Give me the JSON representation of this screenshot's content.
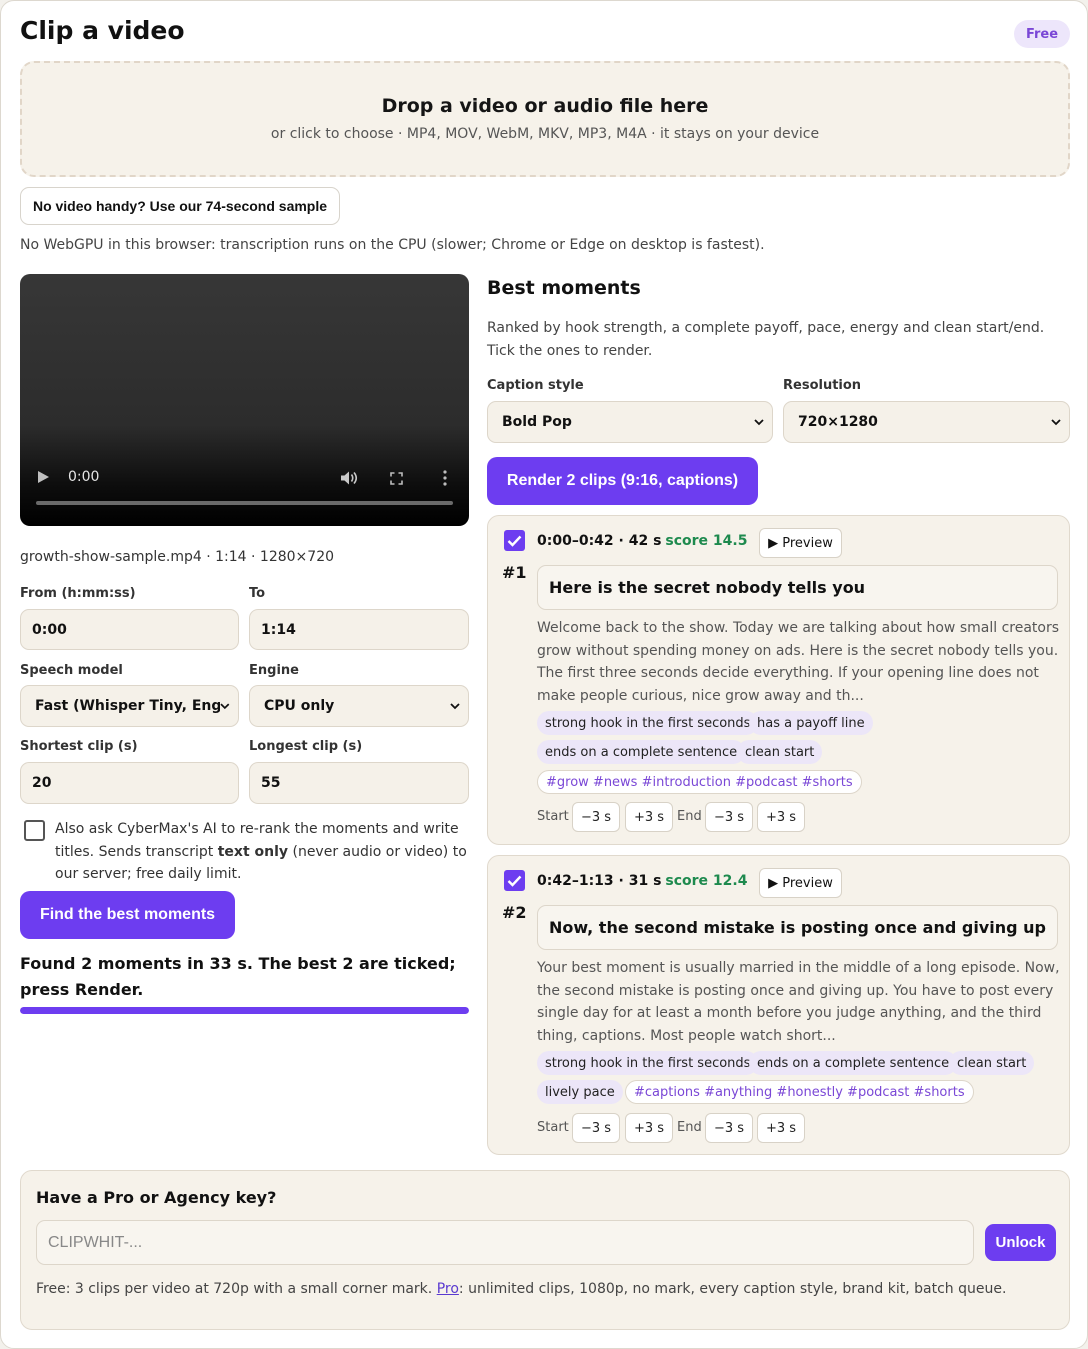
{
  "header": {
    "title": "Clip a video",
    "badge": "Free"
  },
  "dropzone": {
    "title": "Drop a video or audio file here",
    "subtitle": "or click to choose · MP4, MOV, WebM, MKV, MP3, M4A · it stays on your device"
  },
  "sample_button": "No video handy? Use our 74-second sample",
  "webgpu_note": "No WebGPU in this browser: transcription runs on the CPU (slower; Chrome or Edge on desktop is fastest).",
  "player": {
    "current_time": "0:00",
    "progress": 0
  },
  "file_info": "growth-show-sample.mp4 · 1:14 · 1280×720",
  "range": {
    "from_label": "From (h:mm:ss)",
    "from_value": "0:00",
    "to_label": "To",
    "to_value": "1:14"
  },
  "model": {
    "speech_label": "Speech model",
    "speech_value": "Fast (Whisper Tiny, Engl",
    "engine_label": "Engine",
    "engine_value": "CPU only"
  },
  "clip_length": {
    "shortest_label": "Shortest clip (s)",
    "shortest_value": "20",
    "longest_label": "Longest clip (s)",
    "longest_value": "55"
  },
  "ai_option": {
    "checked": false,
    "text_before": "Also ask CyberMax's AI to re-rank the moments and write titles. Sends transcript ",
    "text_bold": "text only",
    "text_after": " (never audio or video) to our server; free daily limit."
  },
  "find_button": "Find the best moments",
  "status": {
    "text": "Found 2 moments in 33 s. The best 2 are ticked; press Render.",
    "progress": 1.0
  },
  "moments": {
    "title": "Best moments",
    "subtitle": "Ranked by hook strength, a complete payoff, pace, energy and clean start/end. Tick the ones to render.",
    "caption_style_label": "Caption style",
    "caption_style_value": "Bold Pop",
    "resolution_label": "Resolution",
    "resolution_value": "720×1280",
    "render_button": "Render 2 clips (9:16, captions)"
  },
  "clips": [
    {
      "checked": true,
      "rank": "#1",
      "range": "0:00–0:42 · 42 s",
      "score": "score 14.5",
      "preview_label": "▶ Preview",
      "title": "Here is the secret nobody tells you",
      "excerpt": "Welcome back to the show. Today we are talking about how small creators grow without spending money on ads. Here is the secret nobody tells you. The first three seconds decide everything. If your opening line does not make people curious, nice grow away and th...",
      "tags": [
        "strong hook in the first seconds",
        "has a payoff line",
        "ends on a complete sentence",
        "clean start"
      ],
      "hashtags": "#grow #news #introduction #podcast #shorts"
    },
    {
      "checked": true,
      "rank": "#2",
      "range": "0:42–1:13 · 31 s",
      "score": "score 12.4",
      "preview_label": "▶ Preview",
      "title": "Now, the second mistake is posting once and giving up",
      "excerpt": "Your best moment is usually married in the middle of a long episode. Now, the second mistake is posting once and giving up. You have to post every single day for at least a month before you judge anything, and the third thing, captions. Most people watch short...",
      "tags": [
        "strong hook in the first seconds",
        "ends on a complete sentence",
        "clean start",
        "lively pace"
      ],
      "hashtags": "#captions #anything #honestly #podcast #shorts"
    }
  ],
  "adjust": {
    "start_label": "Start",
    "end_label": "End",
    "minus": "−3 s",
    "plus": "+3 s"
  },
  "pro": {
    "title": "Have a Pro or Agency key?",
    "placeholder": "CLIPWHIT-...",
    "unlock_button": "Unlock",
    "note_before": "Free: 3 clips per video at 720p with a small corner mark. ",
    "note_link": "Pro",
    "note_after": ": unlimited clips, 1080p, no mark, every caption style, brand kit, batch queue."
  },
  "colors": {
    "accent": "#6d3df0",
    "score": "#1e8a4e",
    "badge_text": "#7a47d6",
    "surface": "#f6f2ea"
  },
  "icons": [
    "play-icon",
    "volume-icon",
    "fullscreen-icon",
    "more-options-icon",
    "chevron-down-icon",
    "checkmark-icon"
  ]
}
